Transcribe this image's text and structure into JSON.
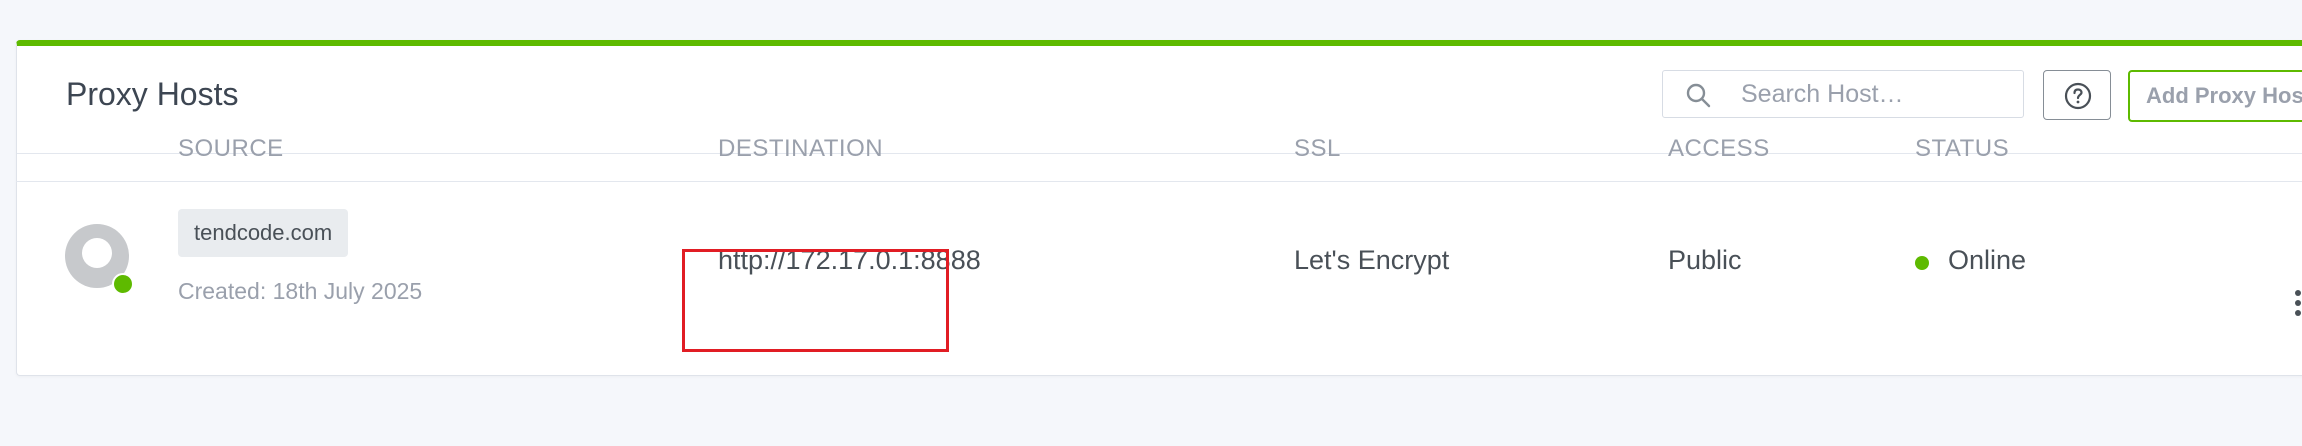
{
  "header": {
    "title": "Proxy Hosts",
    "search_placeholder": "Search Host…",
    "search_value": "",
    "help_icon": "question-circle-icon",
    "add_button_label": "Add Proxy Host"
  },
  "table": {
    "columns": [
      "SOURCE",
      "DESTINATION",
      "SSL",
      "ACCESS",
      "STATUS"
    ],
    "rows": [
      {
        "source": "tendcode.com",
        "created": "Created: 18th July 2025",
        "destination": "http://172.17.0.1:8888",
        "ssl": "Let's Encrypt",
        "access": "Public",
        "status": "Online"
      }
    ]
  },
  "colors": {
    "accent": "#5eba00",
    "highlight": "#e11d24",
    "muted_text": "#9aa0ac",
    "text": "#495057"
  }
}
